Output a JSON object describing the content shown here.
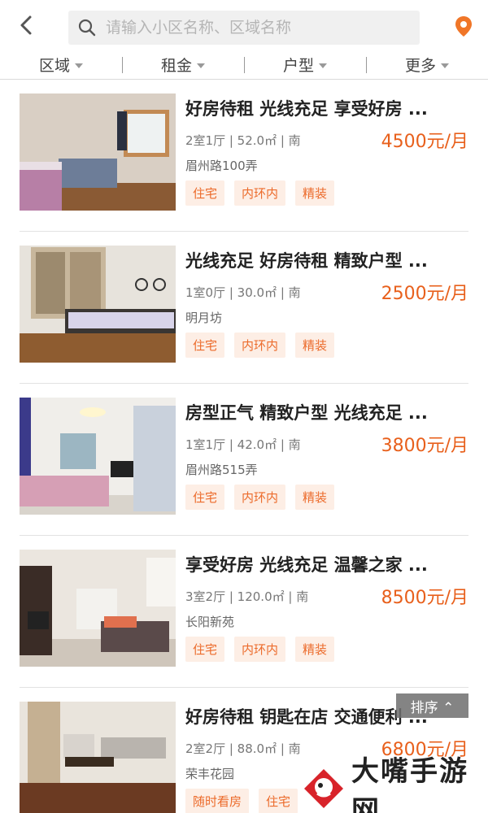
{
  "search": {
    "placeholder": "请输入小区名称、区域名称"
  },
  "filters": [
    {
      "label": "区域"
    },
    {
      "label": "租金"
    },
    {
      "label": "户型"
    },
    {
      "label": "更多"
    }
  ],
  "listings": [
    {
      "title": "好房待租 光线充足 享受好房 ...",
      "layout": "2室1厅 | 52.0㎡ | 南",
      "price": "4500元/月",
      "address": "眉州路100弄",
      "tags": [
        "住宅",
        "内环内",
        "精装"
      ]
    },
    {
      "title": "光线充足 好房待租 精致户型 ...",
      "layout": "1室0厅 | 30.0㎡ | 南",
      "price": "2500元/月",
      "address": "明月坊",
      "tags": [
        "住宅",
        "内环内",
        "精装"
      ]
    },
    {
      "title": "房型正气 精致户型 光线充足 ...",
      "layout": "1室1厅 | 42.0㎡ | 南",
      "price": "3800元/月",
      "address": "眉州路515弄",
      "tags": [
        "住宅",
        "内环内",
        "精装"
      ]
    },
    {
      "title": "享受好房 光线充足 温馨之家 ...",
      "layout": "3室2厅 | 120.0㎡ | 南",
      "price": "8500元/月",
      "address": "长阳新苑",
      "tags": [
        "住宅",
        "内环内",
        "精装"
      ]
    },
    {
      "title": "好房待租 钥匙在店 交通便利 ...",
      "layout": "2室2厅 | 88.0㎡ | 南",
      "price": "6800元/月",
      "address": "荣丰花园",
      "tags": [
        "随时看房",
        "住宅"
      ]
    }
  ],
  "sort_button": {
    "label": "排序 ⌃"
  },
  "watermark": {
    "text": "大嘴手游网"
  },
  "colors": {
    "accent": "#e8601c",
    "tag_bg": "#fdeee5",
    "tag_text": "#ec6b2b"
  }
}
